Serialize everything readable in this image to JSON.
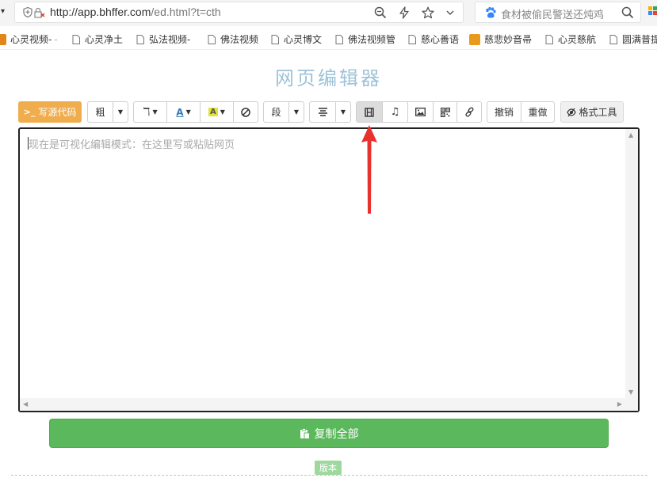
{
  "browser": {
    "url_host": "http://app.bhffer.com",
    "url_path": "/ed.html?t=cth",
    "search_text": "食材被偷民警送还炖鸡"
  },
  "bookmarks": [
    {
      "label": "心灵视频-"
    },
    {
      "label": "心灵净土"
    },
    {
      "label": "弘法视频-"
    },
    {
      "label": "佛法视频"
    },
    {
      "label": "心灵博文"
    },
    {
      "label": "佛法视频管"
    },
    {
      "label": "慈心善语"
    },
    {
      "label": "慈悲妙音帚"
    },
    {
      "label": "心灵慈航"
    },
    {
      "label": "圆满普提"
    }
  ],
  "page": {
    "title": "网页编辑器",
    "source_button": "写源代码",
    "bold": "粗",
    "paragraph": "段",
    "undo": "撤销",
    "redo": "重做",
    "format_tool": "格式工具",
    "editor_placeholder": "现在是可视化编辑模式：在这里写或粘贴网页",
    "copy_all": "复制全部",
    "version": "版本"
  },
  "colors": {
    "source_button": "#f0ad4e",
    "copy_button": "#5cb85c",
    "title": "#9ec3d8",
    "arrow": "#e8322e"
  }
}
